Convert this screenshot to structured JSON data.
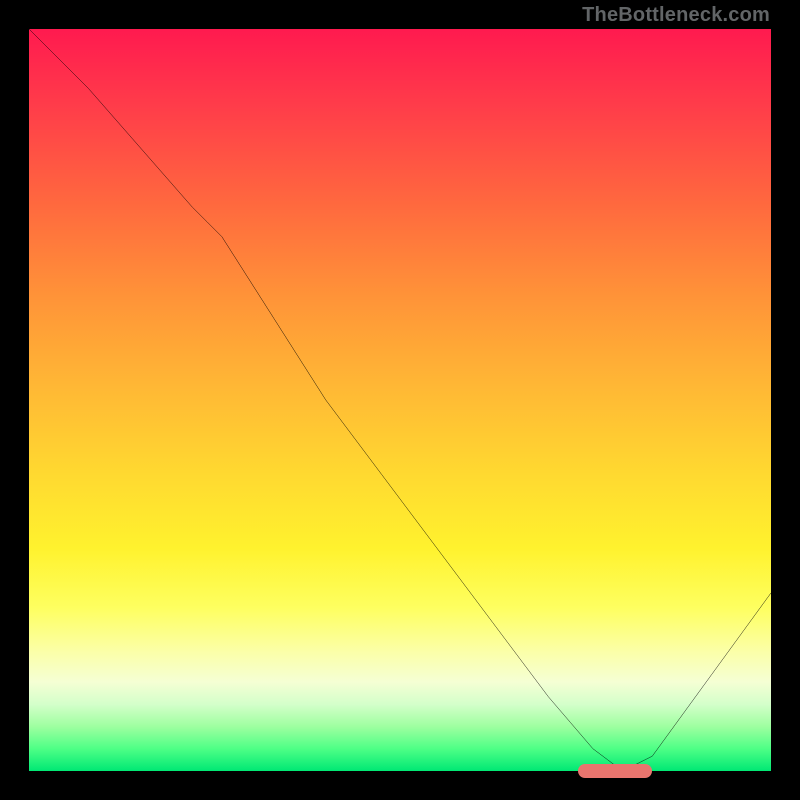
{
  "watermark": "TheBottleneck.com",
  "chart_data": {
    "type": "line",
    "title": "",
    "xlabel": "",
    "ylabel": "",
    "xlim": [
      0,
      100
    ],
    "ylim": [
      0,
      100
    ],
    "grid": false,
    "gradient_stops": [
      {
        "pct": 0,
        "color": "#ff1a4f"
      },
      {
        "pct": 10,
        "color": "#ff3b4a"
      },
      {
        "pct": 24,
        "color": "#ff6a3e"
      },
      {
        "pct": 36,
        "color": "#ff9338"
      },
      {
        "pct": 48,
        "color": "#ffb735"
      },
      {
        "pct": 60,
        "color": "#ffd930"
      },
      {
        "pct": 70,
        "color": "#fff22e"
      },
      {
        "pct": 78,
        "color": "#feff60"
      },
      {
        "pct": 84,
        "color": "#fbffa9"
      },
      {
        "pct": 88,
        "color": "#f5ffd4"
      },
      {
        "pct": 91,
        "color": "#d4ffca"
      },
      {
        "pct": 94,
        "color": "#9effa0"
      },
      {
        "pct": 97,
        "color": "#4eff86"
      },
      {
        "pct": 100,
        "color": "#00e874"
      }
    ],
    "series": [
      {
        "name": "curve",
        "x": [
          0,
          8,
          22,
          26,
          40,
          55,
          70,
          76,
          80,
          84,
          100
        ],
        "y": [
          100,
          92,
          76,
          72,
          50,
          30,
          10,
          3,
          0,
          2,
          24
        ]
      }
    ],
    "marker": {
      "x_start": 74,
      "x_end": 84,
      "y": 0,
      "color": "#e9756e"
    }
  }
}
